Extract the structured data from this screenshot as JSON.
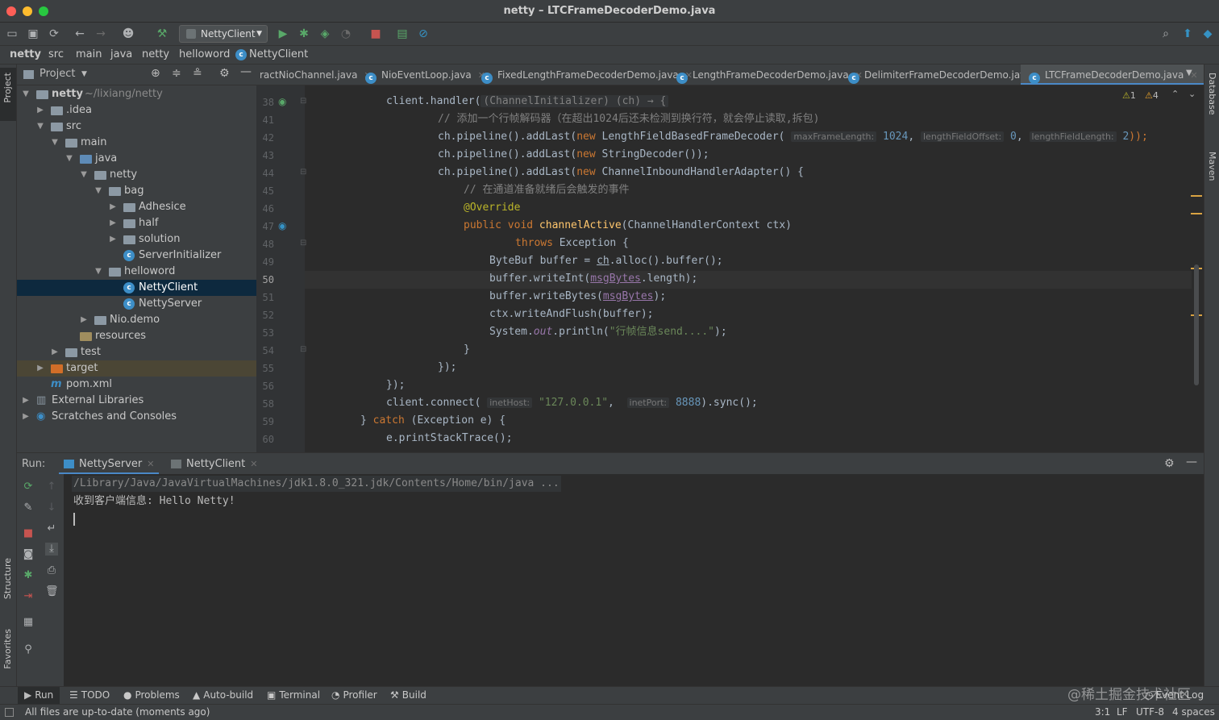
{
  "window": {
    "title": "netty – LTCFrameDecoderDemo.java"
  },
  "toolbar": {
    "run_config": "NettyClient"
  },
  "breadcrumb": [
    "netty",
    "src",
    "main",
    "java",
    "netty",
    "helloword",
    "NettyClient"
  ],
  "project": {
    "header": "Project",
    "tree": [
      {
        "label": "netty",
        "extra": "~/lixiang/netty"
      },
      {
        "label": ".idea"
      },
      {
        "label": "src"
      },
      {
        "label": "main"
      },
      {
        "label": "java"
      },
      {
        "label": "netty"
      },
      {
        "label": "bag"
      },
      {
        "label": "Adhesice"
      },
      {
        "label": "half"
      },
      {
        "label": "solution"
      },
      {
        "label": "ServerInitializer"
      },
      {
        "label": "helloword"
      },
      {
        "label": "NettyClient"
      },
      {
        "label": "NettyServer"
      },
      {
        "label": "Nio.demo"
      },
      {
        "label": "resources"
      },
      {
        "label": "test"
      },
      {
        "label": "target"
      },
      {
        "label": "pom.xml"
      },
      {
        "label": "External Libraries"
      },
      {
        "label": "Scratches and Consoles"
      }
    ]
  },
  "tabs": [
    "ractNioChannel.java",
    "NioEventLoop.java",
    "FixedLengthFrameDecoderDemo.java",
    "LengthFrameDecoderDemo.java",
    "DelimiterFrameDecoderDemo.java",
    "LTCFrameDecoderDemo.java"
  ],
  "editor": {
    "line_numbers": [
      "38",
      "41",
      "42",
      "43",
      "44",
      "45",
      "46",
      "47",
      "48",
      "49",
      "50",
      "51",
      "52",
      "53",
      "54",
      "55",
      "56",
      "58",
      "59",
      "60"
    ],
    "warnings": {
      "weak": "1",
      "strong": "4"
    },
    "code": {
      "l38a": "client.handler(",
      "l38b": "(ChannelInitializer) (ch) → {",
      "l41": "// 添加一个行帧解码器（在超出1024后还未检测到换行符，就会停止读取,拆包)",
      "l42a": "ch.pipeline().addLast(",
      "l42kw": "new",
      "l42b": " LengthFieldBasedFrameDecoder(",
      "l42h1": "maxFrameLength:",
      "l42n1": "1024",
      "l42h2": "lengthFieldOffset:",
      "l42n2": "0",
      "l42h3": "lengthFieldLength:",
      "l42n3": "2",
      "l42c": "));",
      "l43a": "ch.pipeline().addLast(",
      "l43kw": "new",
      "l43b": " StringDecoder());",
      "l44a": "ch.pipeline().addLast(",
      "l44kw": "new",
      "l44b": " ChannelInboundHandlerAdapter() {",
      "l45": "// 在通道准备就绪后会触发的事件",
      "l46": "@Override",
      "l47kw": "public void",
      "l47fn": "channelActive",
      "l47b": "(ChannelHandlerContext ctx)",
      "l48kw": "throws",
      "l48b": " Exception {",
      "l49a": "ByteBuf buffer = ",
      "l49ch": "ch",
      "l49b": ".alloc().buffer();",
      "l50a": "buffer.writeInt(",
      "l50v": "msgBytes",
      "l50b": ".length);",
      "l51a": "buffer.writeBytes(",
      "l51v": "msgBytes",
      "l51b": ");",
      "l52": "ctx.writeAndFlush(buffer);",
      "l53a": "System.",
      "l53s": "out",
      "l53b": ".println(",
      "l53str": "\"行帧信息send....\"",
      "l53c": ");",
      "l54": "}",
      "l55": "});",
      "l56": "});",
      "l58a": "client.connect(",
      "l58h1": "inetHost:",
      "l58s": "\"127.0.0.1\"",
      "l58h2": "inetPort:",
      "l58n": "8888",
      "l58b": ").sync();",
      "l59a": "} ",
      "l59kw": "catch",
      "l59b": " (Exception e) {",
      "l60": "e.printStackTrace();"
    }
  },
  "run": {
    "label": "Run:",
    "tabs": [
      "NettyServer",
      "NettyClient"
    ],
    "console": [
      "/Library/Java/JavaVirtualMachines/jdk1.8.0_321.jdk/Contents/Home/bin/java ...",
      "收到客户端信息: Hello Netty!"
    ]
  },
  "side_labels": {
    "project": "Project",
    "structure": "Structure",
    "favorites": "Favorites",
    "database": "Database",
    "maven": "Maven"
  },
  "bottom_tools": [
    "Run",
    "TODO",
    "Problems",
    "Auto-build",
    "Terminal",
    "Profiler",
    "Build"
  ],
  "event_log": "Event Log",
  "watermark": "@稀土掘金技术社区",
  "status": {
    "message": "All files are up-to-date (moments ago)",
    "position": "3:1",
    "line_sep": "LF",
    "encoding": "UTF-8",
    "indent": "4 spaces"
  }
}
